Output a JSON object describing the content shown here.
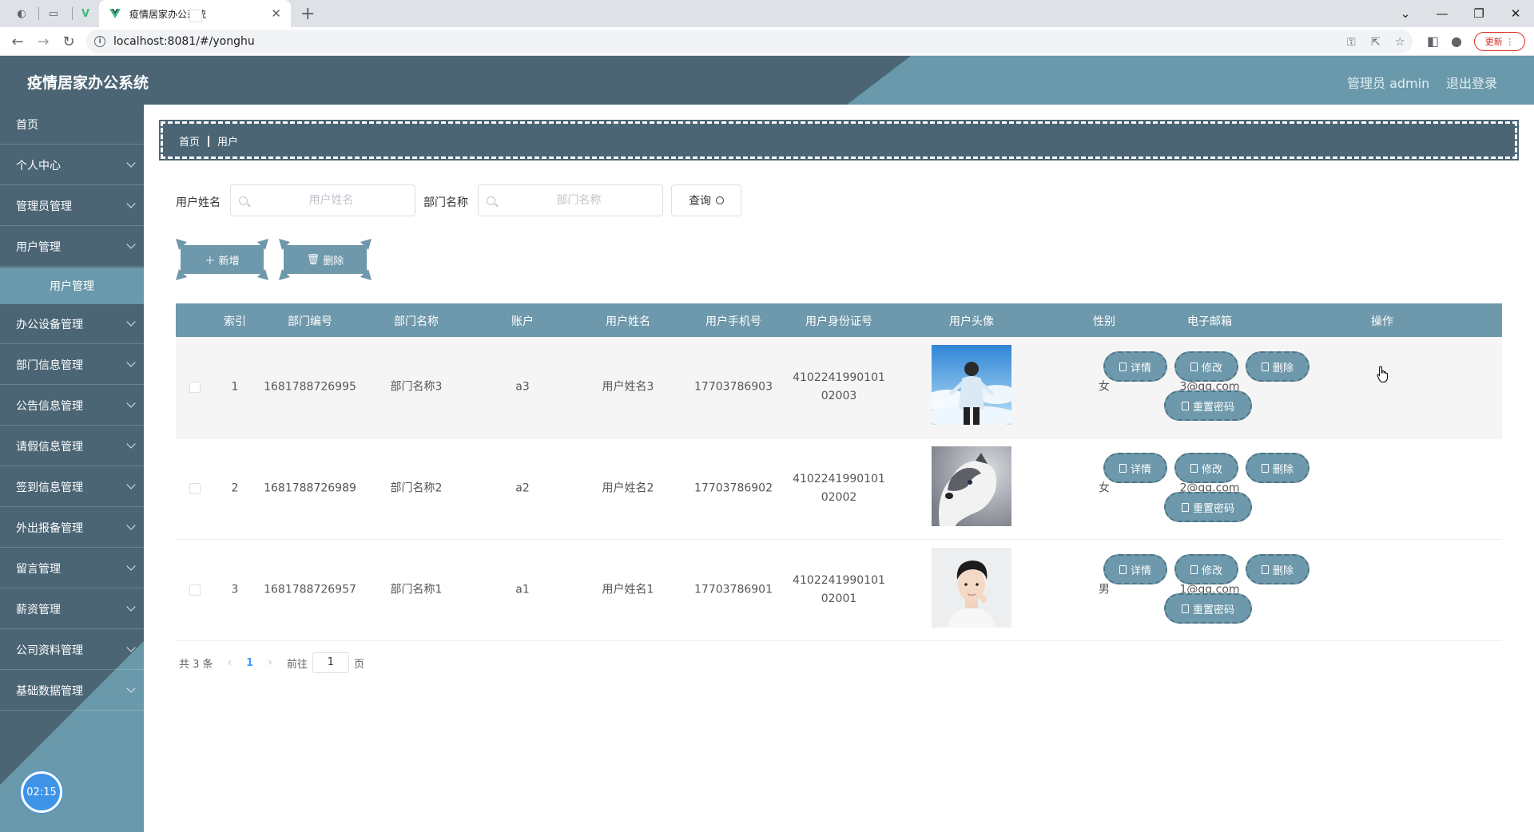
{
  "browser": {
    "tab_title": "疫情居家办公系统",
    "url": "localhost:8081/#/yonghu",
    "update_label": "更新"
  },
  "header": {
    "app_title": "疫情居家办公系统",
    "user_label": "管理员 admin",
    "logout_label": "退出登录"
  },
  "sidebar": {
    "items": [
      {
        "label": "首页",
        "has_children": false
      },
      {
        "label": "个人中心",
        "has_children": true
      },
      {
        "label": "管理员管理",
        "has_children": true
      },
      {
        "label": "用户管理",
        "has_children": true
      },
      {
        "label": "办公设备管理",
        "has_children": true
      },
      {
        "label": "部门信息管理",
        "has_children": true
      },
      {
        "label": "公告信息管理",
        "has_children": true
      },
      {
        "label": "请假信息管理",
        "has_children": true
      },
      {
        "label": "签到信息管理",
        "has_children": true
      },
      {
        "label": "外出报备管理",
        "has_children": true
      },
      {
        "label": "留言管理",
        "has_children": true
      },
      {
        "label": "薪资管理",
        "has_children": true
      },
      {
        "label": "公司资料管理",
        "has_children": true
      },
      {
        "label": "基础数据管理",
        "has_children": true
      }
    ],
    "active_sub": "用户管理",
    "clock": "02:15"
  },
  "breadcrumb": [
    "首页",
    "用户"
  ],
  "search": {
    "name_label": "用户姓名",
    "name_placeholder": "用户姓名",
    "dept_label": "部门名称",
    "dept_placeholder": "部门名称",
    "query_label": "查询"
  },
  "actions": {
    "add_label": "新增",
    "delete_label": "删除"
  },
  "table": {
    "columns": [
      "索引",
      "部门编号",
      "部门名称",
      "账户",
      "用户姓名",
      "用户手机号",
      "用户身份证号",
      "用户头像",
      "性别",
      "电子邮箱",
      "操作"
    ],
    "rows": [
      {
        "index": "1",
        "dept_no": "1681788726995",
        "dept_name": "部门名称3",
        "account": "a3",
        "name": "用户姓名3",
        "phone": "17703786903",
        "id_line1": "4102241990101",
        "id_line2": "02003",
        "avatar": "photo-boy-sky",
        "gender": "女",
        "email": "3@qq.com"
      },
      {
        "index": "2",
        "dept_no": "1681788726989",
        "dept_name": "部门名称2",
        "account": "a2",
        "name": "用户姓名2",
        "phone": "17703786902",
        "id_line1": "4102241990101",
        "id_line2": "02002",
        "avatar": "photo-husky",
        "gender": "女",
        "email": "2@qq.com"
      },
      {
        "index": "3",
        "dept_no": "1681788726957",
        "dept_name": "部门名称1",
        "account": "a1",
        "name": "用户姓名1",
        "phone": "17703786901",
        "id_line1": "4102241990101",
        "id_line2": "02001",
        "avatar": "photo-young-man",
        "gender": "男",
        "email": "1@qq.com"
      }
    ],
    "ops": {
      "detail": "详情",
      "edit": "修改",
      "delete": "删除",
      "reset": "重置密码"
    }
  },
  "pager": {
    "total": "共 3 条",
    "current": "1",
    "goto_prefix": "前往",
    "goto_value": "1",
    "goto_suffix": "页"
  },
  "colors": {
    "primary": "#4b6575",
    "accent": "#6e98ab",
    "sub_active": "#6999ab"
  }
}
